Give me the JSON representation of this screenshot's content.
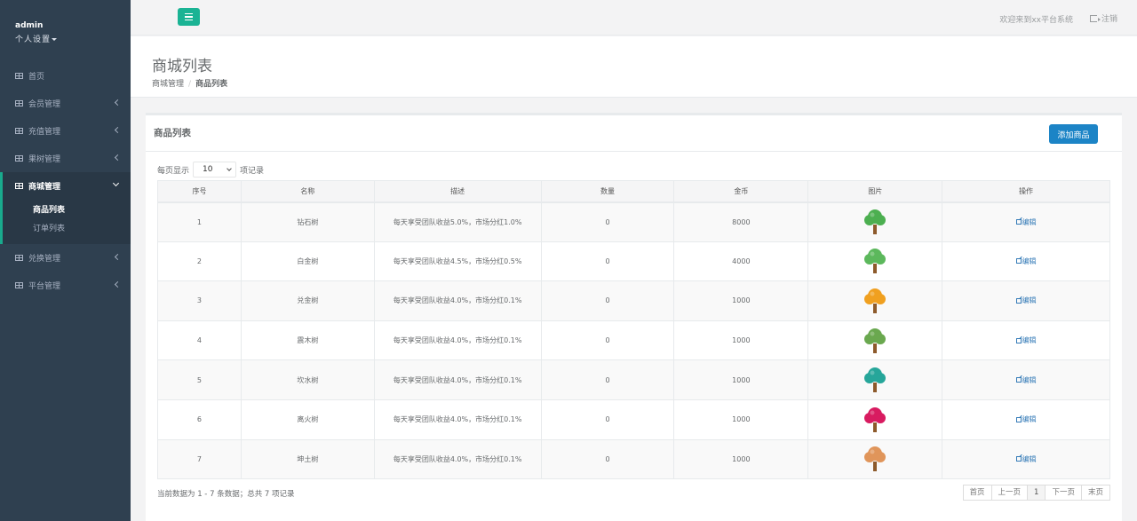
{
  "sidebar": {
    "user": "admin",
    "settings": "个人设置",
    "items": [
      {
        "label": "首页"
      },
      {
        "label": "会员管理"
      },
      {
        "label": "充值管理"
      },
      {
        "label": "果树管理"
      },
      {
        "label": "商城管理"
      },
      {
        "label": "兑换管理"
      },
      {
        "label": "平台管理"
      }
    ],
    "sub_items": [
      {
        "label": "商品列表"
      },
      {
        "label": "订单列表"
      }
    ]
  },
  "topbar": {
    "welcome": "欢迎来到xx平台系统",
    "logout": "注销"
  },
  "heading": {
    "title": "商城列表",
    "crumb1": "商城管理",
    "crumb2": "商品列表"
  },
  "card": {
    "title": "商品列表",
    "add_button": "添加商品",
    "length_prefix": "每页显示",
    "length_value": "10",
    "length_suffix": "项记录"
  },
  "table": {
    "headers": [
      "序号",
      "名称",
      "描述",
      "数量",
      "金币",
      "图片",
      "操作"
    ],
    "edit_label": "编辑",
    "rows": [
      {
        "id": "1",
        "name": "钻石树",
        "desc": "每天享受团队收益5.0%，市场分红1.0%",
        "qty": "0",
        "gold": "8000",
        "tree_color": "#4caf50"
      },
      {
        "id": "2",
        "name": "白金树",
        "desc": "每天享受团队收益4.5%，市场分红0.5%",
        "qty": "0",
        "gold": "4000",
        "tree_color": "#5cb85c"
      },
      {
        "id": "3",
        "name": "兑金树",
        "desc": "每天享受团队收益4.0%，市场分红0.1%",
        "qty": "0",
        "gold": "1000",
        "tree_color": "#f0a020"
      },
      {
        "id": "4",
        "name": "震木树",
        "desc": "每天享受团队收益4.0%，市场分红0.1%",
        "qty": "0",
        "gold": "1000",
        "tree_color": "#6aa84f"
      },
      {
        "id": "5",
        "name": "坎水树",
        "desc": "每天享受团队收益4.0%，市场分红0.1%",
        "qty": "0",
        "gold": "1000",
        "tree_color": "#26a69a"
      },
      {
        "id": "6",
        "name": "离火树",
        "desc": "每天享受团队收益4.0%，市场分红0.1%",
        "qty": "0",
        "gold": "1000",
        "tree_color": "#d81b60"
      },
      {
        "id": "7",
        "name": "坤土树",
        "desc": "每天享受团队收益4.0%，市场分红0.1%",
        "qty": "0",
        "gold": "1000",
        "tree_color": "#e0955a"
      }
    ]
  },
  "footer": {
    "info": "当前数据为 1 - 7 条数据；总共 7 项记录",
    "pager": [
      "首页",
      "上一页",
      "1",
      "下一页",
      "末页"
    ]
  }
}
